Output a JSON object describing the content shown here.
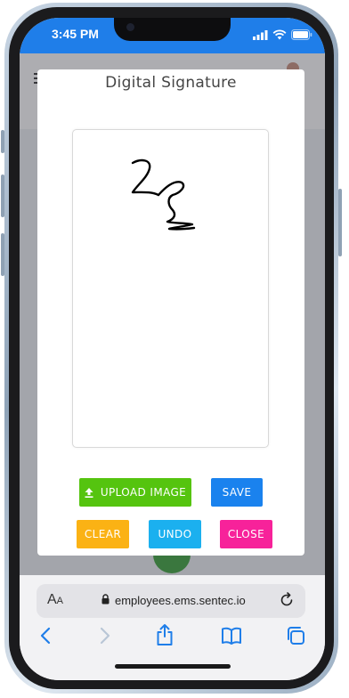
{
  "status_bar": {
    "time": "3:45 PM"
  },
  "modal": {
    "title": "Digital Signature",
    "buttons": {
      "upload": {
        "label": "UPLOAD IMAGE",
        "color": "#55c40f"
      },
      "save": {
        "label": "SAVE",
        "color": "#1a82ee"
      },
      "clear": {
        "label": "CLEAR",
        "color": "#fbb214"
      },
      "undo": {
        "label": "UNDO",
        "color": "#1bb0ef"
      },
      "close": {
        "label": "CLOSE",
        "color": "#f7229a"
      }
    }
  },
  "browser": {
    "text_size_label": "AA",
    "url": "employees.ems.sentec.io"
  },
  "colors": {
    "status_bar": "#1f7ee9",
    "overlay": "#8e8f95"
  }
}
